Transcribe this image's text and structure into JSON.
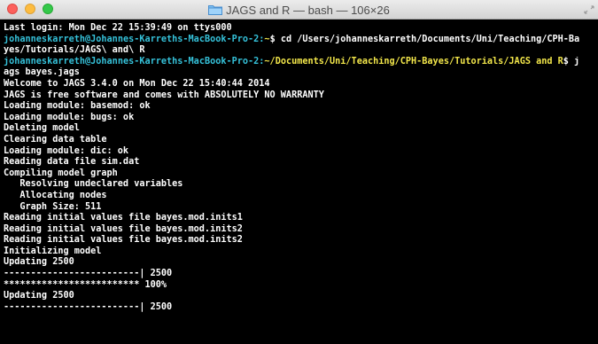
{
  "window": {
    "title": "JAGS and R — bash — 106×26"
  },
  "terminal": {
    "last_login": "Last login: Mon Dec 22 15:39:49 on ttys000",
    "prompt1": {
      "user": "johanneskarreth",
      "host": "@Johannes-Karreths-MacBook-Pro-2:",
      "path": "~",
      "symbol": "$",
      "command": " cd /Users/johanneskarreth/Documents/Uni/Teaching/CPH-Ba"
    },
    "wrap1": "yes/Tutorials/JAGS\\ and\\ R",
    "prompt2": {
      "user": "johanneskarreth",
      "host": "@Johannes-Karreths-MacBook-Pro-2:",
      "path": "~/Documents/Uni/Teaching/CPH-Bayes/Tutorials/JAGS and R",
      "symbol": "$",
      "command": " j"
    },
    "output": [
      "ags bayes.jags",
      "Welcome to JAGS 3.4.0 on Mon Dec 22 15:40:44 2014",
      "JAGS is free software and comes with ABSOLUTELY NO WARRANTY",
      "Loading module: basemod: ok",
      "Loading module: bugs: ok",
      "Deleting model",
      "Clearing data table",
      "Loading module: dic: ok",
      "Reading data file sim.dat",
      "Compiling model graph",
      "   Resolving undeclared variables",
      "   Allocating nodes",
      "   Graph Size: 511",
      "Reading initial values file bayes.mod.inits1",
      "Reading initial values file bayes.mod.inits2",
      "Reading initial values file bayes.mod.inits2",
      "Initializing model",
      "Updating 2500",
      "-------------------------| 2500",
      "************************* 100%",
      "Updating 2500",
      "-------------------------| 2500"
    ]
  }
}
